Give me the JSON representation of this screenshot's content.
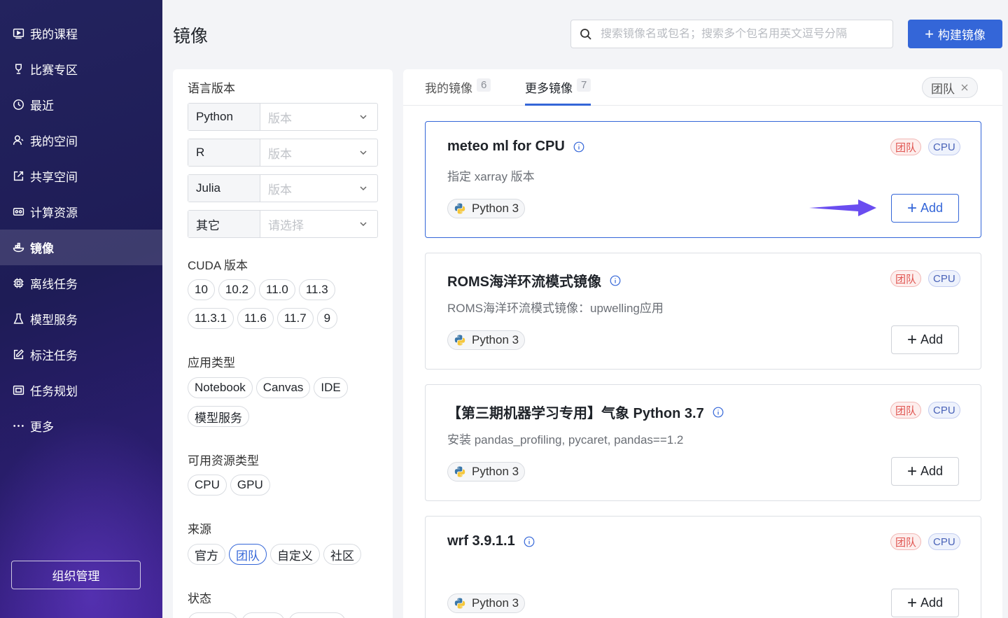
{
  "sidebar": {
    "items": [
      {
        "label": "我的课程",
        "icon": "course-icon"
      },
      {
        "label": "比赛专区",
        "icon": "trophy-icon"
      },
      {
        "label": "最近",
        "icon": "clock-icon"
      },
      {
        "label": "我的空间",
        "icon": "user-icon"
      },
      {
        "label": "共享空间",
        "icon": "share-icon"
      },
      {
        "label": "计算资源",
        "icon": "compute-icon"
      },
      {
        "label": "镜像",
        "icon": "image-icon",
        "active": true
      },
      {
        "label": "离线任务",
        "icon": "chip-icon"
      },
      {
        "label": "模型服务",
        "icon": "flask-icon"
      },
      {
        "label": "标注任务",
        "icon": "edit-icon"
      },
      {
        "label": "任务规划",
        "icon": "plan-icon"
      },
      {
        "label": "更多",
        "icon": "more-icon"
      }
    ],
    "org_button": "组织管理"
  },
  "header": {
    "title": "镜像",
    "search_placeholder": "搜索镜像名或包名；搜索多个包名用英文逗号分隔",
    "build_button": "构建镜像"
  },
  "filters": {
    "language_label": "语言版本",
    "languages": [
      {
        "name": "Python",
        "placeholder": "版本"
      },
      {
        "name": "R",
        "placeholder": "版本"
      },
      {
        "name": "Julia",
        "placeholder": "版本"
      },
      {
        "name": "其它",
        "placeholder": "请选择"
      }
    ],
    "cuda_label": "CUDA 版本",
    "cuda_versions": [
      "10",
      "10.2",
      "11.0",
      "11.3",
      "11.3.1",
      "11.6",
      "11.7",
      "9"
    ],
    "app_type_label": "应用类型",
    "app_types": [
      "Notebook",
      "Canvas",
      "IDE",
      "模型服务"
    ],
    "resource_label": "可用资源类型",
    "resources": [
      "CPU",
      "GPU"
    ],
    "source_label": "来源",
    "sources": [
      "官方",
      "团队",
      "自定义",
      "社区"
    ],
    "source_selected": "团队",
    "status_label": "状态"
  },
  "tabs": [
    {
      "label": "我的镜像",
      "count": "6"
    },
    {
      "label": "更多镜像",
      "count": "7",
      "active": true
    }
  ],
  "active_filter": "团队",
  "cards": [
    {
      "title": "meteo ml for CPU",
      "desc": "指定 xarray 版本",
      "team": "团队",
      "cpu": "CPU",
      "python": "Python 3",
      "add": "Add",
      "highlight": true
    },
    {
      "title": "ROMS海洋环流模式镜像",
      "desc": "ROMS海洋环流模式镜像：upwelling应用",
      "team": "团队",
      "cpu": "CPU",
      "python": "Python 3",
      "add": "Add"
    },
    {
      "title": "【第三期机器学习专用】气象 Python 3.7",
      "desc": "安装 pandas_profiling, pycaret, pandas==1.2",
      "team": "团队",
      "cpu": "CPU",
      "python": "Python 3",
      "add": "Add"
    },
    {
      "title": "wrf 3.9.1.1",
      "desc": "",
      "team": "团队",
      "cpu": "CPU",
      "python": "Python 3",
      "add": "Add"
    }
  ],
  "colors": {
    "accent": "#3466d8",
    "arrow": "#6a4df0",
    "team_badge": "#e0534f",
    "cpu_badge": "#4a63b8"
  }
}
